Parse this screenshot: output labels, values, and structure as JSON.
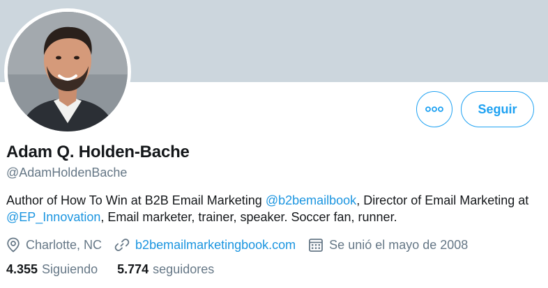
{
  "colors": {
    "banner": "#ccd6dd",
    "accent": "#1da1f2",
    "link": "#1b95e0",
    "muted": "#657786",
    "text": "#14171a"
  },
  "profile": {
    "name": "Adam Q. Holden-Bache",
    "handle": "@AdamHoldenBache",
    "bio": {
      "part1": "Author of How To Win at B2B Email Marketing ",
      "mention1": "@b2bemailbook",
      "part2": ", Director of Email Marketing at ",
      "mention2": "@EP_Innovation",
      "part3": ", Email marketer, trainer, speaker. Soccer fan, runner."
    },
    "location": "Charlotte, NC",
    "website": "b2bemailmarketingbook.com",
    "joined": "Se unió el mayo de 2008"
  },
  "actions": {
    "more_icon": "more-horizontal-icon",
    "follow_label": "Seguir"
  },
  "stats": {
    "following_count": "4.355",
    "following_label": "Siguiendo",
    "followers_count": "5.774",
    "followers_label": "seguidores"
  },
  "icons": {
    "location": "location-pin-icon",
    "link": "link-icon",
    "calendar": "calendar-icon"
  }
}
